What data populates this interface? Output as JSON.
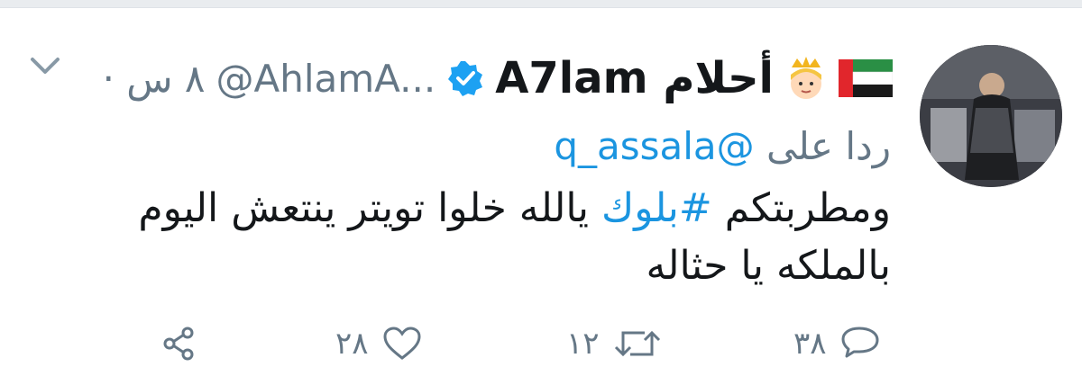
{
  "tweet": {
    "display_name": "A7lam أحلام",
    "handle": "@AhlamA...",
    "timestamp": "· ٨ س",
    "reply_prefix": "ردا على",
    "reply_mention": "@q_assala",
    "body_prefix": "ومطربتكم",
    "hashtag": "#بلوك",
    "body_suffix": "يالله خلوا تويتر ينتعش اليوم",
    "body_line2": "بالملكه يا حثاله"
  },
  "actions": {
    "reply_count": "٣٨",
    "retweet_count": "١٢",
    "like_count": "٢٨"
  },
  "icons": {
    "flag": "uae-flag-icon",
    "emoji": "princess-emoji-icon",
    "verified": "verified-badge-icon",
    "chevron": "chevron-down-icon",
    "reply": "reply-icon",
    "retweet": "retweet-icon",
    "like": "heart-icon",
    "share": "share-icon"
  },
  "colors": {
    "link": "#1b95e0",
    "muted": "#657786",
    "text": "#14171a",
    "verified": "#1da1f2"
  }
}
